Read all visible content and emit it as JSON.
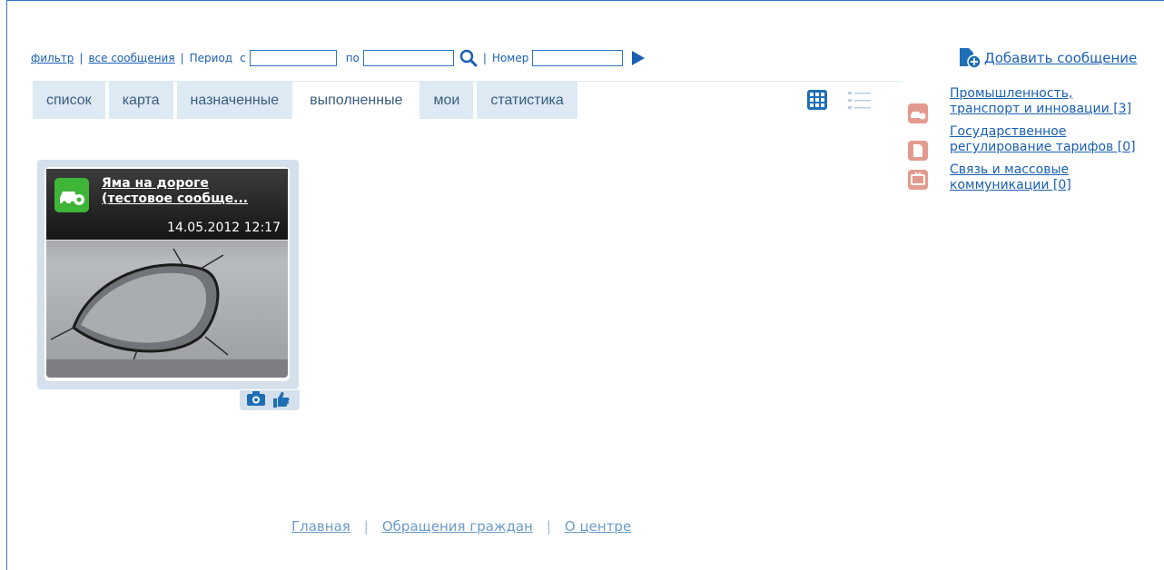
{
  "filter": {
    "filter_label": "фильтр",
    "all_label": "все сообщения",
    "period_label": "Период",
    "from_label": "с",
    "to_label": "по",
    "number_label": "Номер",
    "from_value": "",
    "to_value": "",
    "number_value": ""
  },
  "add_message_label": "Добавить сообщение",
  "tabs": [
    {
      "label": "список"
    },
    {
      "label": "карта"
    },
    {
      "label": "назначенные"
    },
    {
      "label": "выполненные"
    },
    {
      "label": "мои"
    },
    {
      "label": "статистика"
    }
  ],
  "active_tab": "выполненные",
  "card": {
    "title": "Яма на дороге (тестовое сообще...",
    "date": "14.05.2012 12:17",
    "icon": "gear-car-icon"
  },
  "categories": [
    {
      "label": "Промышленность, транспорт и инновации [3]",
      "icon": "gear-car-icon"
    },
    {
      "label": "Государственное регулирование тарифов [0]",
      "icon": "document-icon"
    },
    {
      "label": "Связь и массовые коммуникации [0]",
      "icon": "tv-icon"
    }
  ],
  "footer": {
    "links": [
      "Главная",
      "Обращения граждан",
      "О центре"
    ]
  },
  "colors": {
    "accent": "#1a5fb4",
    "tab_bg": "#dde9f3",
    "card_icon": "#3fb538",
    "category_icon": "#e39a8e"
  }
}
